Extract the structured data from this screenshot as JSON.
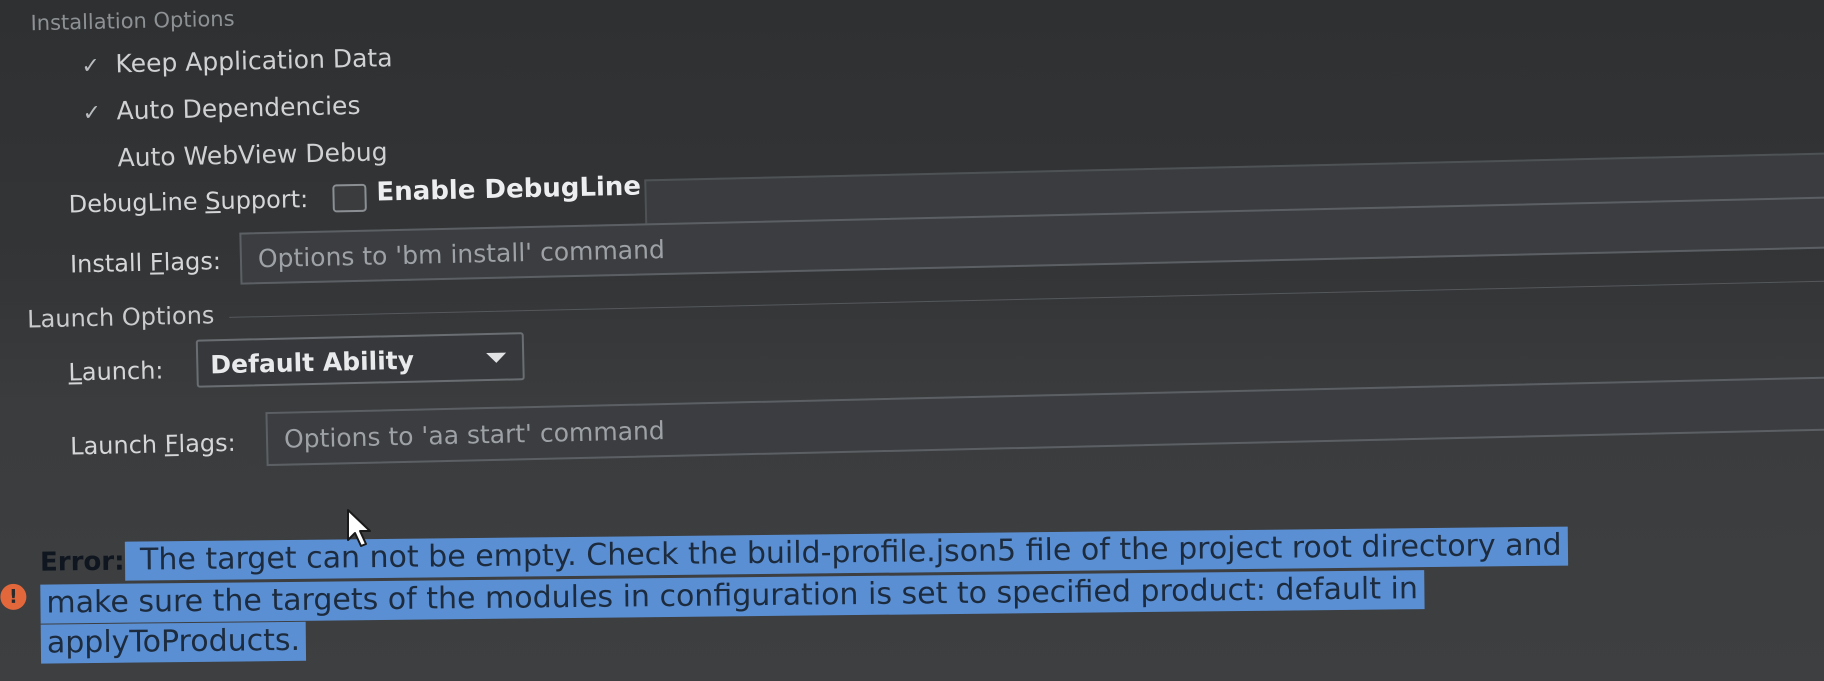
{
  "installation": {
    "title": "Installation Options",
    "options": [
      {
        "label": "Keep Application Data",
        "checked": true
      },
      {
        "label": "Auto Dependencies",
        "checked": true
      },
      {
        "label": "Auto WebView Debug",
        "checked": false
      }
    ],
    "check_glyph": "✓",
    "debugline": {
      "label_pre": "DebugLine ",
      "label_mn": "S",
      "label_post": "upport:",
      "checkbox_label": "Enable DebugLine",
      "checked": false
    },
    "install_flags": {
      "label_pre": "Install ",
      "label_mn": "F",
      "label_post": "lags:",
      "placeholder": "Options to 'bm install' command",
      "value": ""
    }
  },
  "launch": {
    "title": "Launch Options",
    "launch_select": {
      "label_mn": "L",
      "label_post": "aunch:",
      "value": "Default Ability"
    },
    "launch_flags": {
      "label_pre": "Launch ",
      "label_mn": "F",
      "label_post": "lags:",
      "placeholder": "Options to 'aa start' command",
      "value": ""
    }
  },
  "error": {
    "icon_glyph": "!",
    "prefix": "Error:",
    "line1": " The target can not be empty. Check the build-profile.json5 file of the project root directory and",
    "line2": "make sure the targets of the modules in configuration is set to specified product: default in",
    "line3": "applyToProducts."
  },
  "colors": {
    "background": "#2f3133",
    "selection": "#5b8fd3",
    "error_icon": "#e2683c"
  }
}
